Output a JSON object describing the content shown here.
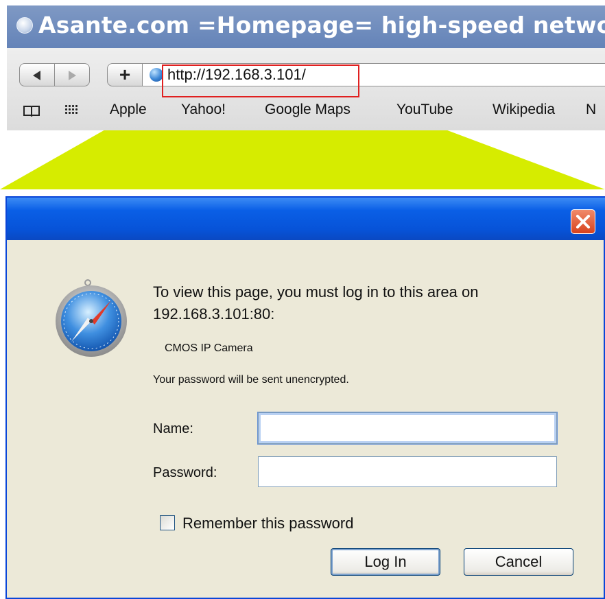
{
  "browser": {
    "window_title": "Asante.com =Homepage= high-speed network",
    "url": "http://192.168.3.101/",
    "bookmarks": [
      "Apple",
      "Yahoo!",
      "Google Maps",
      "YouTube",
      "Wikipedia",
      "N"
    ]
  },
  "dialog": {
    "message": "To view this page, you must log in to this area on 192.168.3.101:80:",
    "realm": "CMOS IP Camera",
    "warning": "Your password will be sent unencrypted.",
    "name_label": "Name:",
    "name_value": "",
    "password_label": "Password:",
    "password_value": "",
    "remember_label": "Remember this password",
    "remember_checked": false,
    "login_label": "Log In",
    "cancel_label": "Cancel"
  },
  "colors": {
    "callout": "#d6ec00",
    "url_highlight": "#e02020",
    "dialog_titlebar": "#0753d8",
    "dialog_body": "#ece9d8"
  },
  "icons": [
    "title-page-icon",
    "back-icon",
    "forward-icon",
    "add-icon",
    "globe-icon",
    "bookmarks-book-icon",
    "top-sites-grid-icon",
    "close-icon",
    "safari-compass-icon"
  ]
}
